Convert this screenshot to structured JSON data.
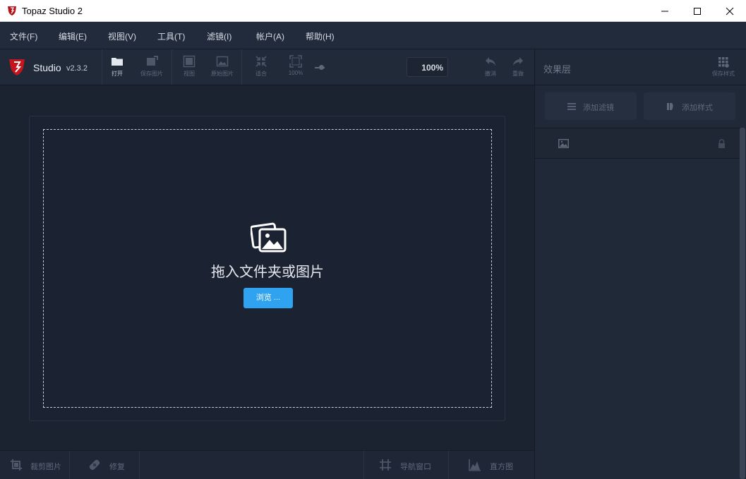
{
  "window": {
    "title": "Topaz Studio 2",
    "controls": [
      "minimize",
      "maximize",
      "close"
    ]
  },
  "menu": [
    {
      "label": "文件(F)"
    },
    {
      "label": "编辑(E)"
    },
    {
      "label": "视图(V)"
    },
    {
      "label": "工具(T)"
    },
    {
      "label": "滤镜(I)"
    },
    {
      "label": "帐户(A)"
    },
    {
      "label": "帮助(H)"
    }
  ],
  "toolbar": {
    "brand": "Studio",
    "version": "v2.3.2",
    "buttons": {
      "open": {
        "label": "打开",
        "icon": "folder-icon"
      },
      "save_image": {
        "label": "保存图片",
        "icon": "save-image-icon"
      },
      "view": {
        "label": "视图",
        "icon": "view-icon"
      },
      "original": {
        "label": "原始图片",
        "icon": "original-image-icon"
      },
      "fit": {
        "label": "适合",
        "icon": "fit-icon"
      },
      "zoom100": {
        "label": "100%",
        "icon": "fullscreen-icon"
      },
      "undo": {
        "label": "撤消",
        "icon": "undo-icon"
      },
      "redo": {
        "label": "重做",
        "icon": "redo-icon"
      }
    },
    "zoom_value": "100%"
  },
  "right_panel": {
    "title": "效果层",
    "save_style": "保存样式",
    "add_filter": "添加滤镜",
    "add_style": "添加样式"
  },
  "canvas": {
    "drop_text": "拖入文件夹或图片",
    "browse": "浏览 ..."
  },
  "bottom_bar": {
    "crop": "裁剪图片",
    "repair": "修复",
    "navigator": "导航窗口",
    "histogram": "直方图"
  },
  "colors": {
    "accent": "#2fa3f0",
    "background": "#1b2230",
    "panel": "#222b3b"
  }
}
